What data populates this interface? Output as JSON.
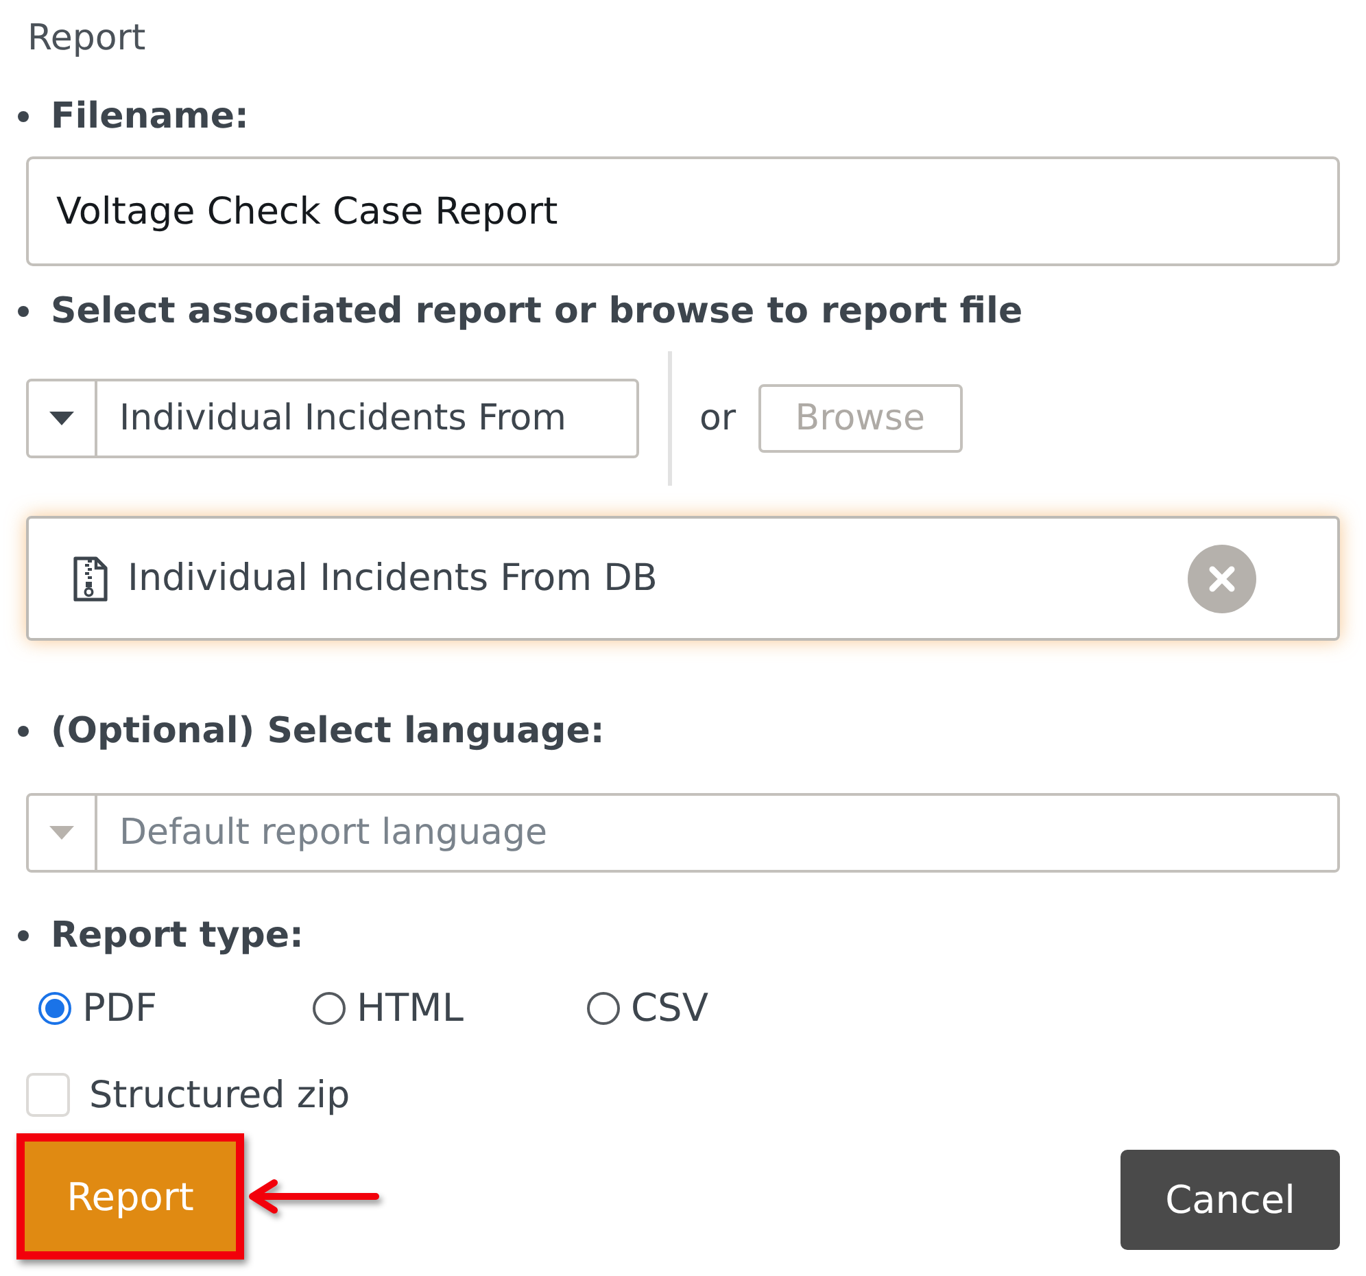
{
  "dialog": {
    "title": "Report"
  },
  "filename": {
    "label": "Filename:",
    "value": "Voltage Check Case Report"
  },
  "associated_report": {
    "label": "Select associated report or browse to report file",
    "select_value": "Individual Incidents From",
    "separator": "or",
    "browse_button": {
      "label": "Browse",
      "disabled": true
    },
    "selected_file": {
      "name": "Individual Incidents From DB"
    }
  },
  "language": {
    "label": "(Optional) Select language:",
    "placeholder": "Default report language"
  },
  "report_type": {
    "label": "Report type:",
    "options": [
      {
        "label": "PDF",
        "selected": true
      },
      {
        "label": "HTML",
        "selected": false
      },
      {
        "label": "CSV",
        "selected": false
      }
    ]
  },
  "structured_zip": {
    "label": "Structured zip",
    "checked": false
  },
  "buttons": [
    {
      "kind": "primary",
      "label": "Report",
      "highlighted": true
    },
    {
      "kind": "secondary",
      "label": "Cancel",
      "highlighted": false
    }
  ]
}
